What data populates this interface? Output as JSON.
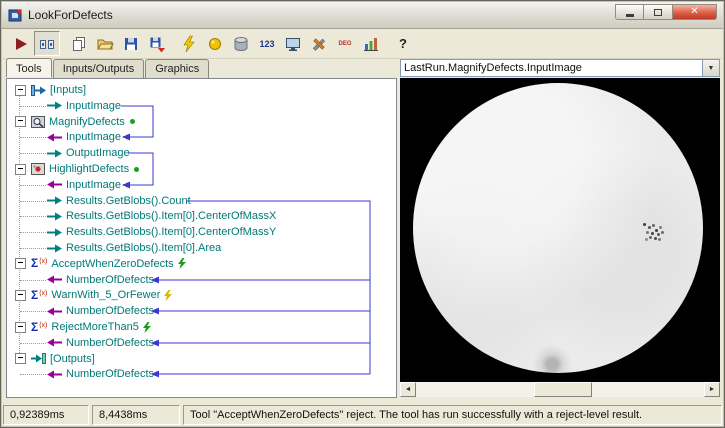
{
  "window": {
    "title": "LookForDefects"
  },
  "toolbar": {
    "numeric_label": "123",
    "debug_label": "DEG",
    "help_label": "?",
    "button_names": [
      "run",
      "run-mode-toggle",
      "copy",
      "open",
      "save",
      "save-export",
      "reset",
      "power",
      "database",
      "numeric",
      "display",
      "options",
      "debug",
      "profile",
      "help"
    ]
  },
  "tabs": {
    "items": [
      {
        "label": "Tools",
        "active": true
      },
      {
        "label": "Inputs/Outputs",
        "active": false
      },
      {
        "label": "Graphics",
        "active": false
      }
    ]
  },
  "icons": {
    "sigma": "Σ",
    "sigma_sub": "(x)",
    "combo_arrow": "▼",
    "scroll_left": "◄",
    "scroll_right": "►"
  },
  "tree": {
    "rows": [
      {
        "label": "[Inputs]",
        "icon": "inputs-block-icon"
      },
      {
        "label": "InputImage",
        "icon": "output-pin-arrow"
      },
      {
        "label": "MagnifyDefects",
        "icon": "magnify-tool-icon",
        "status": "green-dot"
      },
      {
        "label": "InputImage",
        "icon": "input-pin-arrow"
      },
      {
        "label": "OutputImage",
        "icon": "output-pin-arrow"
      },
      {
        "label": "HighlightDefects",
        "icon": "highlight-tool-icon",
        "status": "green-dot"
      },
      {
        "label": "InputImage",
        "icon": "input-pin-arrow"
      },
      {
        "label": "Results.GetBlobs().Count",
        "icon": "output-pin-arrow"
      },
      {
        "label": "Results.GetBlobs().Item[0].CenterOfMassX",
        "icon": "output-pin-arrow"
      },
      {
        "label": "Results.GetBlobs().Item[0].CenterOfMassY",
        "icon": "output-pin-arrow"
      },
      {
        "label": "Results.GetBlobs().Item[0].Area",
        "icon": "output-pin-arrow"
      },
      {
        "label": "AcceptWhenZeroDefects",
        "icon": "sigma-tool-icon",
        "status": "green-flash"
      },
      {
        "label": "NumberOfDefects",
        "icon": "input-pin-arrow"
      },
      {
        "label": "WarnWith_5_OrFewer",
        "icon": "sigma-tool-icon",
        "status": "yellow-flash"
      },
      {
        "label": "NumberOfDefects",
        "icon": "input-pin-arrow"
      },
      {
        "label": "RejectMoreThan5",
        "icon": "sigma-tool-icon",
        "status": "green-flash"
      },
      {
        "label": "NumberOfDefects",
        "icon": "input-pin-arrow"
      },
      {
        "label": "[Outputs]",
        "icon": "outputs-block-icon"
      },
      {
        "label": "NumberOfDefects",
        "icon": "input-pin-arrow"
      }
    ]
  },
  "right_panel": {
    "dropdown_value": "LastRun.MagnifyDefects.InputImage"
  },
  "statusbar": {
    "time1": "0,92389ms",
    "time2": "8,4438ms",
    "message": "Tool \"AcceptWhenZeroDefects\" reject. The tool has run successfully with a reject-level result."
  },
  "colors": {
    "tree_text": "#007878",
    "input_pin": "#990099",
    "output_pin": "#008080",
    "connector": "#3a3ad0",
    "status_green": "#11a31e",
    "status_yellow": "#d6b800"
  }
}
